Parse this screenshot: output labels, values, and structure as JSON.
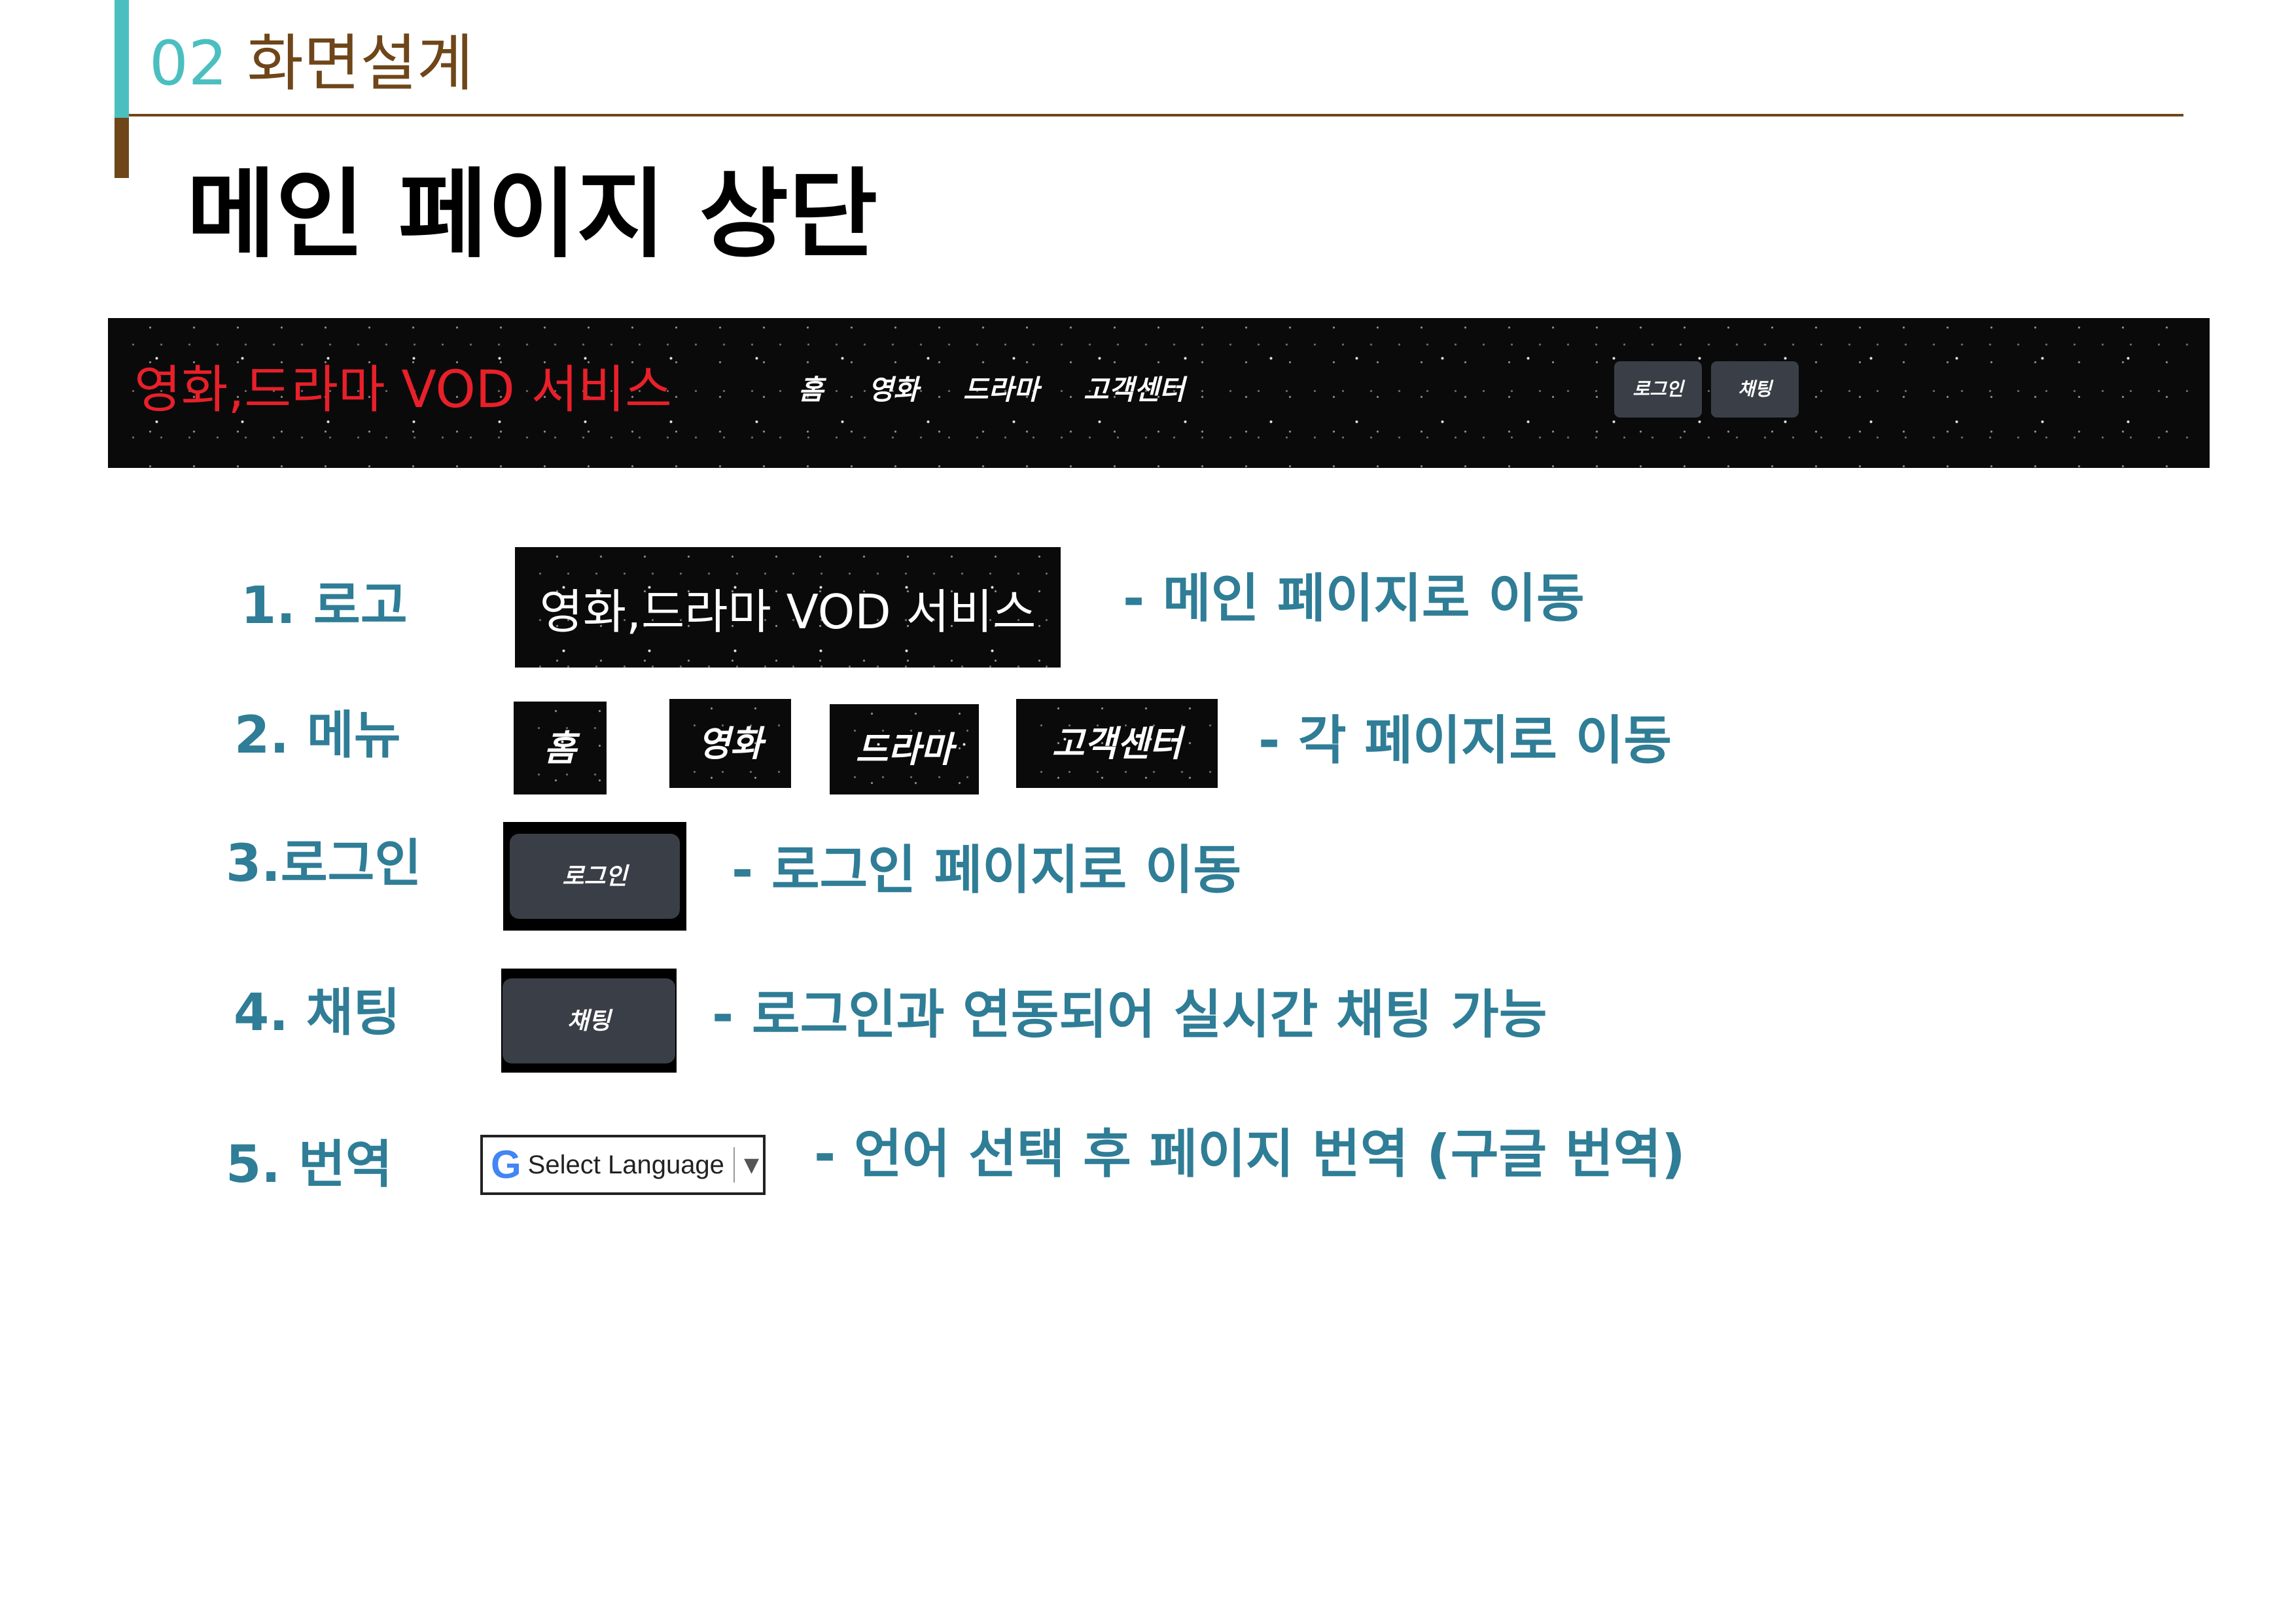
{
  "header": {
    "section_number": "02",
    "section_title": "화면설계",
    "page_title": "메인 페이지 상단"
  },
  "site_header": {
    "logo": "영화,드라마 VOD 서비스",
    "nav": [
      "홈",
      "영화",
      "드라마",
      "고객센터"
    ],
    "login_button": "로그인",
    "chat_button": "채팅"
  },
  "features": [
    {
      "label": "1. 로고",
      "sample": "영화,드라마 VOD 서비스",
      "description": "- 메인 페이지로 이동"
    },
    {
      "label": "2. 메뉴",
      "samples": [
        "홈",
        "영화",
        "드라마",
        "고객센터"
      ],
      "description": "- 각 페이지로 이동"
    },
    {
      "label": "3.로그인",
      "sample": "로그인",
      "description": "- 로그인 페이지로 이동"
    },
    {
      "label": "4. 채팅",
      "sample": "채팅",
      "description": "- 로그인과 연동되어 실시간 채팅 가능"
    },
    {
      "label": "5. 번역",
      "sample": "Select Language",
      "description": "- 언어 선택 후 페이지 번역 (구글 번역)"
    }
  ],
  "translate_widget": {
    "logo": "G",
    "arrow": "▼"
  },
  "colors": {
    "teal": "#4bbfc0",
    "brown": "#6e4619",
    "label_blue": "#2f7d96",
    "logo_red": "#e8202a",
    "button_gray": "#3a3f47"
  }
}
